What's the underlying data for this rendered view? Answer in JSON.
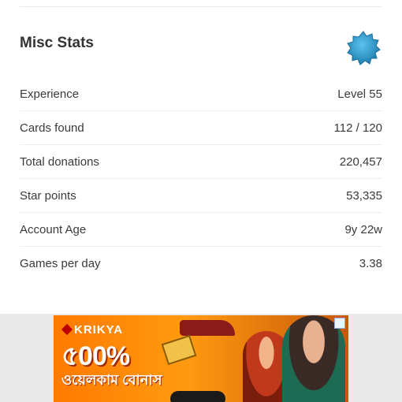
{
  "card": {
    "title": "Misc Stats",
    "icon": "gear-badge-icon",
    "accent_color": "#2a94c8"
  },
  "stats": [
    {
      "label": "Experience",
      "value": "Level 55"
    },
    {
      "label": "Cards found",
      "value": "112 / 120"
    },
    {
      "label": "Total donations",
      "value": "220,457"
    },
    {
      "label": "Star points",
      "value": "53,335"
    },
    {
      "label": "Account Age",
      "value": "9y 22w"
    },
    {
      "label": "Games per day",
      "value": "3.38"
    }
  ],
  "ad": {
    "brand": "KRIKYA",
    "headline": "৫00%",
    "subline": "ওয়েলকাম বোনাস"
  }
}
